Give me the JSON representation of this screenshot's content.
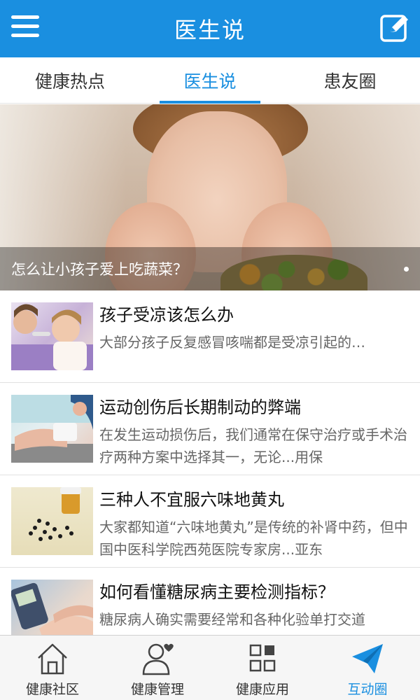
{
  "header": {
    "title": "医生说",
    "menu_icon": "hamburger-menu-icon",
    "compose_icon": "edit-compose-icon"
  },
  "tabs": [
    {
      "label": "健康热点",
      "active": false
    },
    {
      "label": "医生说",
      "active": true
    },
    {
      "label": "患友圈",
      "active": false
    }
  ],
  "banner": {
    "caption": "怎么让小孩子爱上吃蔬菜？"
  },
  "articles": [
    {
      "title": "孩子受凉该怎么办",
      "summary": "大部分孩子反复感冒咳喘都是受凉引起的…"
    },
    {
      "title": "运动创伤后长期制动的弊端",
      "summary": "在发生运动损伤后，我们通常在保守治疗或手术治疗两种方案中选择其一，无论...用保"
    },
    {
      "title": "三种人不宜服六味地黄丸",
      "summary": "大家都知道“六味地黄丸”是传统的补肾中药，但中国中医科学院西苑医院专家房...亚东"
    },
    {
      "title": "如何看懂糖尿病主要检测指标？",
      "summary": "糖尿病人确实需要经常和各种化验单打交道"
    }
  ],
  "bottom_nav": [
    {
      "label": "健康社区",
      "icon": "home-icon",
      "active": false
    },
    {
      "label": "健康管理",
      "icon": "user-heart-icon",
      "active": false
    },
    {
      "label": "健康应用",
      "icon": "grid-apps-icon",
      "active": false
    },
    {
      "label": "互动圈",
      "icon": "paper-plane-icon",
      "active": true
    }
  ],
  "colors": {
    "accent": "#1a8fe0",
    "text": "#222222",
    "subtext": "#666666"
  }
}
